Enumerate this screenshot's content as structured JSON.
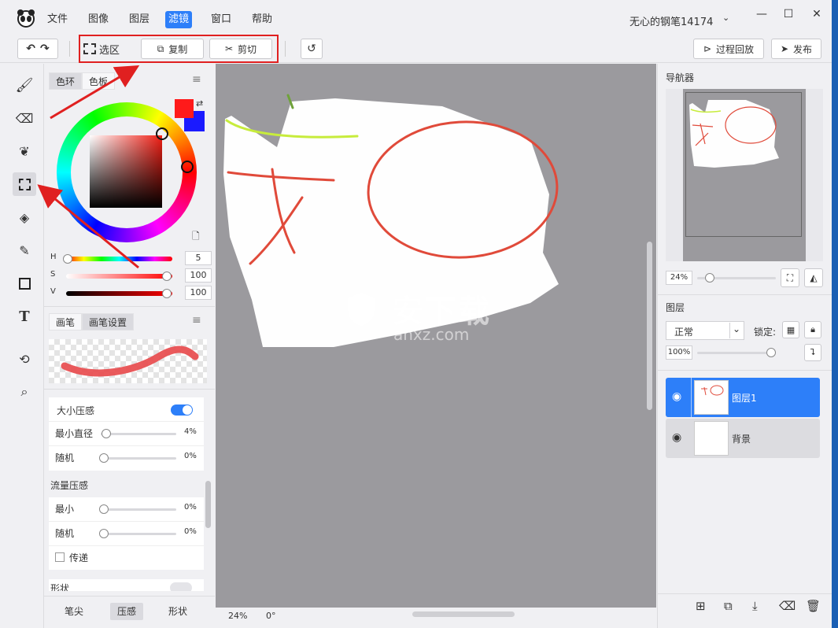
{
  "menu": {
    "items": [
      "文件",
      "图像",
      "图层",
      "滤镜",
      "窗口",
      "帮助"
    ],
    "active_index": 3
  },
  "title": {
    "document": "无心的钢笔14174"
  },
  "toolbar": {
    "select_label": "选区",
    "copy_label": "复制",
    "cut_label": "剪切",
    "replay_label": "过程回放",
    "publish_label": "发布"
  },
  "color_panel": {
    "tabs": [
      "色环",
      "色板"
    ],
    "active_tab": 0,
    "primary_color": "#ff1a1a",
    "secondary_color": "#1a1aff",
    "sliders": [
      {
        "label": "H",
        "value": "5",
        "position": 0.02
      },
      {
        "label": "S",
        "value": "100",
        "position": 1.0
      },
      {
        "label": "V",
        "value": "100",
        "position": 1.0
      }
    ]
  },
  "brush_panel": {
    "tabs": [
      "画笔",
      "画笔设置"
    ],
    "active_tab": 1,
    "size_pressure": {
      "label": "大小压感",
      "enabled": true
    },
    "min_diameter": {
      "label": "最小直径",
      "value": "4%",
      "position": 0.04
    },
    "random1": {
      "label": "随机",
      "value": "0%",
      "position": 0
    },
    "flow_title": "流量压感",
    "flow_min": {
      "label": "最小",
      "value": "0%",
      "position": 0
    },
    "random2": {
      "label": "随机",
      "value": "0%",
      "position": 0
    },
    "transfer_label": "传递",
    "shape_partial": "形状",
    "bottom_tabs": [
      "笔尖",
      "压感",
      "形状"
    ],
    "bottom_active": 1
  },
  "status": {
    "zoom": "24%",
    "angle": "0°"
  },
  "navigator": {
    "title": "导航器",
    "zoom": "24%",
    "zoom_position": 0.12
  },
  "layers": {
    "title": "图层",
    "blend_mode": "正常",
    "lock_label": "锁定:",
    "opacity": "100%",
    "opacity_position": 1.0,
    "items": [
      {
        "name": "图层1",
        "selected": true
      },
      {
        "name": "背景",
        "selected": false
      }
    ]
  },
  "watermark": {
    "text": "安下载",
    "sub": "anxz.com"
  },
  "colors": {
    "accent": "#2d7ff9",
    "annotation_red": "#e02020"
  }
}
